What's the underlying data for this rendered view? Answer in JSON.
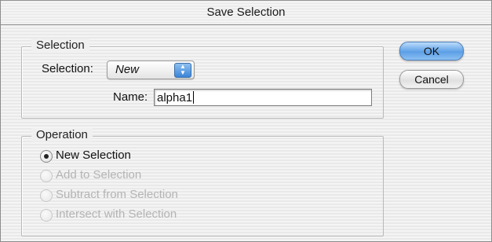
{
  "window": {
    "title": "Save Selection"
  },
  "selection_group": {
    "title": "Selection",
    "selection_label": "Selection:",
    "selection_value": "New",
    "name_label": "Name:",
    "name_value": "alpha1"
  },
  "operation_group": {
    "title": "Operation",
    "options": [
      {
        "label": "New Selection",
        "checked": true,
        "enabled": true
      },
      {
        "label": "Add to Selection",
        "checked": false,
        "enabled": false
      },
      {
        "label": "Subtract from Selection",
        "checked": false,
        "enabled": false
      },
      {
        "label": "Intersect with Selection",
        "checked": false,
        "enabled": false
      }
    ]
  },
  "buttons": {
    "ok": "OK",
    "cancel": "Cancel"
  },
  "colors": {
    "accent": "#5c9fe6",
    "disabled_text": "#b4b4b4"
  }
}
